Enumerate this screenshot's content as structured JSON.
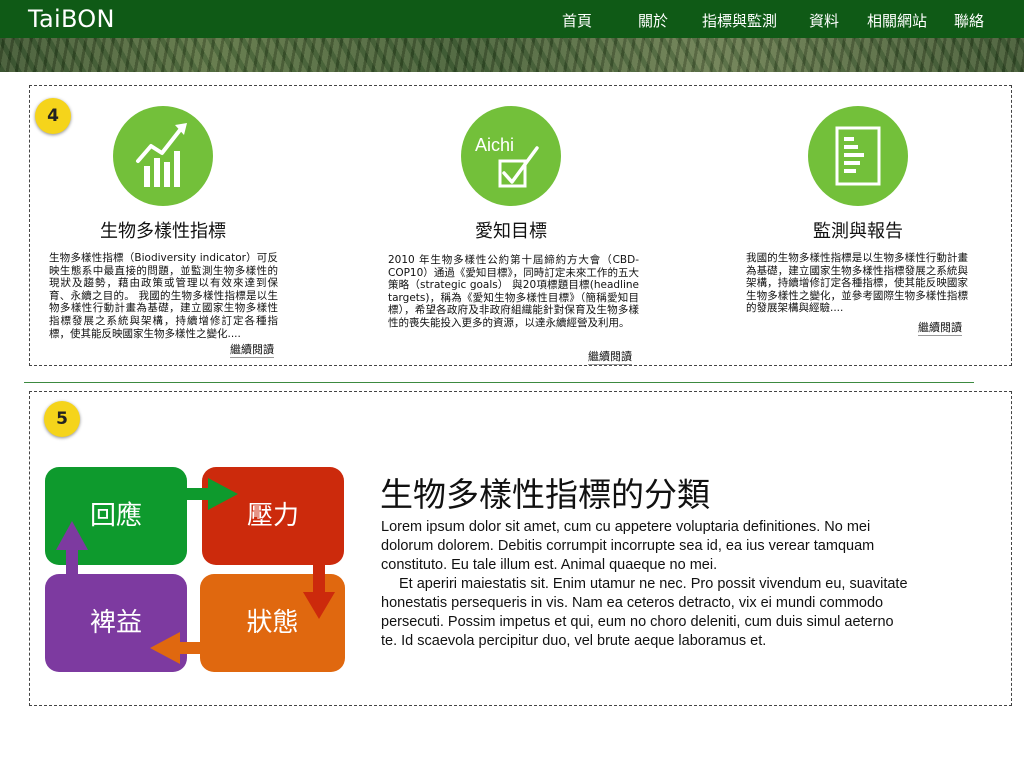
{
  "header": {
    "logo": "TaiBON",
    "nav": [
      {
        "label": "首頁"
      },
      {
        "label": "關於"
      },
      {
        "label": "指標與監測"
      },
      {
        "label": "資料"
      },
      {
        "label": "相關網站"
      },
      {
        "label": "聯絡"
      }
    ]
  },
  "section4": {
    "badge": "4",
    "features": [
      {
        "icon": "growth-chart-icon",
        "title": "生物多樣性指標",
        "text": "生物多樣性指標（Biodiversity indicator）可反映生態系中最直接的問題，並監測生物多樣性的現狀及趨勢，藉由政策或管理以有效來達到保育、永續之目的。 我國的生物多樣性指標是以生物多樣性行動計畫為基礎，建立國家生物多樣性指標發展之系統與架構，持續增修訂定各種指標，使其能反映國家生物多樣性之變化....",
        "read_more": "繼續閱讀"
      },
      {
        "icon": "aichi-check-icon",
        "icon_text": "Aichi",
        "title": "愛知目標",
        "text": "2010 年生物多樣性公約第十屆締約方大會（CBD-COP10）通過《愛知目標》，同時訂定未來工作的五大策略（strategic goals） 與20項標題目標(headline targets)，稱為《愛知生物多樣性目標》（簡稱愛知目標），希望各政府及非政府組織能針對保育及生物多樣性的喪失能投入更多的資源，以達永續經營及利用。",
        "read_more": "繼續閱讀"
      },
      {
        "icon": "report-document-icon",
        "title": "監測與報告",
        "text": "我國的生物多樣性指標是以生物多樣性行動計畫為基礎，建立國家生物多樣性指標發展之系統與架構，持續增修訂定各種指標，使其能反映國家生物多樣性之變化，並參考國際生物多樣性指標的發展架構與經驗....",
        "read_more": "繼續閱讀"
      }
    ]
  },
  "section5": {
    "badge": "5",
    "diagram": {
      "response": "回應",
      "pressure": "壓力",
      "state": "狀態",
      "benefit": "裨益",
      "colors": {
        "response": "#0e9a2d",
        "pressure": "#cc2a0c",
        "state": "#e0680f",
        "benefit": "#7d3aa0"
      }
    },
    "title": "生物多樣性指標的分類",
    "paragraphs": [
      "Lorem ipsum dolor sit amet, cum cu appetere voluptaria definitiones. No mei dolorum dolorem. Debitis corrumpit incorrupte sea id, ea ius verear tamquam constituto. Eu tale illum est. Animal quaeque no mei.",
      "Et aperiri maiestatis sit. Enim utamur ne nec. Pro possit vivendum eu, suavitate honestatis persequeris in vis. Nam ea ceteros detracto, vix ei mundi commodo persecuti. Possim impetus et qui, eum no choro deleniti, cum duis simul aeterno te. Id scaevola percipitur duo, vel brute aeque laboramus et."
    ]
  }
}
